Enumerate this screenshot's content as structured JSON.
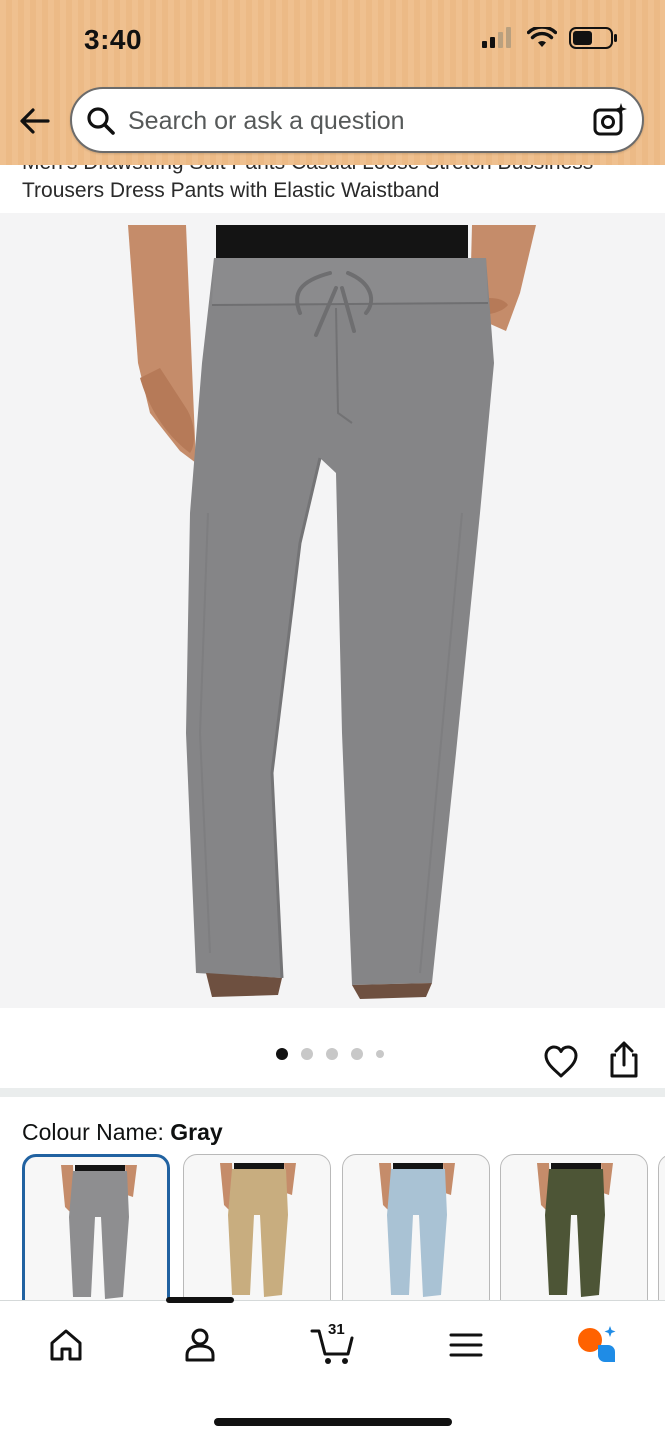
{
  "status_bar": {
    "time": "3:40"
  },
  "header": {
    "search_placeholder": "Search or ask a question",
    "icons": [
      "back-arrow-icon",
      "search-icon",
      "camera-search-icon"
    ],
    "brand_color": "#EFC08F"
  },
  "product": {
    "title": "Men's Drawstring Suit Pants Casual Loose Stretch Bussiness Trousers Dress Pants with Elastic Waistband",
    "image_count": 5,
    "active_image_index": 0
  },
  "colour": {
    "label": "Colour Name:",
    "selected": "Gray",
    "swatches": [
      {
        "color": "#8e8e90",
        "selected": true
      },
      {
        "color": "#c8ad7f",
        "selected": false
      },
      {
        "color": "#a9c2d4",
        "selected": false
      },
      {
        "color": "#4d5536",
        "selected": false
      }
    ]
  },
  "bottom_nav": {
    "cart_count": "31",
    "items": [
      "home-icon",
      "account-icon",
      "cart-icon",
      "menu-icon",
      "rufus-ai-icon"
    ]
  },
  "colors": {
    "accent_selected": "#2162A1",
    "rufus_orange": "#FF6200",
    "rufus_blue": "#1F8CE6"
  }
}
